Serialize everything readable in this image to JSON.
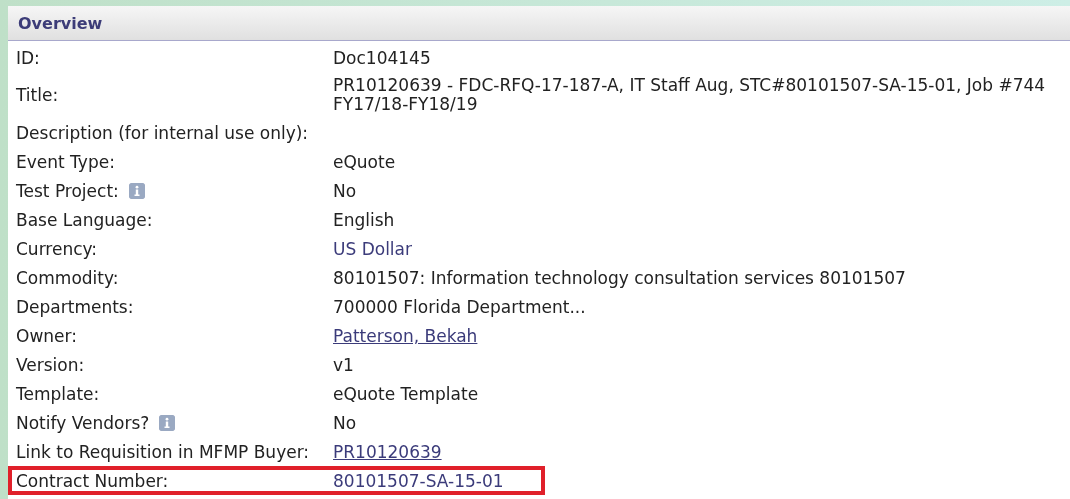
{
  "panel": {
    "title": "Overview"
  },
  "rows": [
    {
      "label": "ID:",
      "value": "Doc104145",
      "kind": "text",
      "info": false,
      "highlighted": false
    },
    {
      "label": "Title:",
      "value_lines": [
        "PR10120639 - FDC-RFQ-17-187-A, IT Staff Aug, STC#80101507-SA-15-01, Job #744",
        "FY17/18-FY18/19"
      ],
      "kind": "multiline",
      "info": false,
      "highlighted": false
    },
    {
      "label": "Description (for internal use only):",
      "kind": "empty",
      "info": false,
      "highlighted": false
    },
    {
      "label": "Event Type:",
      "value": "eQuote",
      "kind": "text",
      "info": false,
      "highlighted": false
    },
    {
      "label": "Test Project:",
      "value": "No",
      "kind": "text",
      "info": true,
      "highlighted": false
    },
    {
      "label": "Base Language:",
      "value": "English",
      "kind": "text",
      "info": false,
      "highlighted": false
    },
    {
      "label": "Currency:",
      "value": "US Dollar",
      "kind": "accent",
      "info": false,
      "highlighted": false
    },
    {
      "label": "Commodity:",
      "value": "80101507: Information technology consultation services 80101507",
      "kind": "text",
      "info": false,
      "highlighted": false
    },
    {
      "label": "Departments:",
      "value": "700000 Florida Department...",
      "kind": "text",
      "info": false,
      "highlighted": false
    },
    {
      "label": "Owner:",
      "value": "Patterson, Bekah",
      "kind": "link",
      "info": false,
      "highlighted": false
    },
    {
      "label": "Version:",
      "value": "v1",
      "kind": "text",
      "info": false,
      "highlighted": false
    },
    {
      "label": "Template:",
      "value": "eQuote Template",
      "kind": "text",
      "info": false,
      "highlighted": false
    },
    {
      "label": "Notify Vendors?",
      "value": "No",
      "kind": "text",
      "info": true,
      "highlighted": false
    },
    {
      "label": "Link to Requisition in MFMP Buyer:",
      "value": "PR10120639",
      "kind": "link",
      "info": false,
      "highlighted": false
    },
    {
      "label": "Contract Number:",
      "value": "80101507-SA-15-01",
      "kind": "accent",
      "info": false,
      "highlighted": true
    }
  ]
}
